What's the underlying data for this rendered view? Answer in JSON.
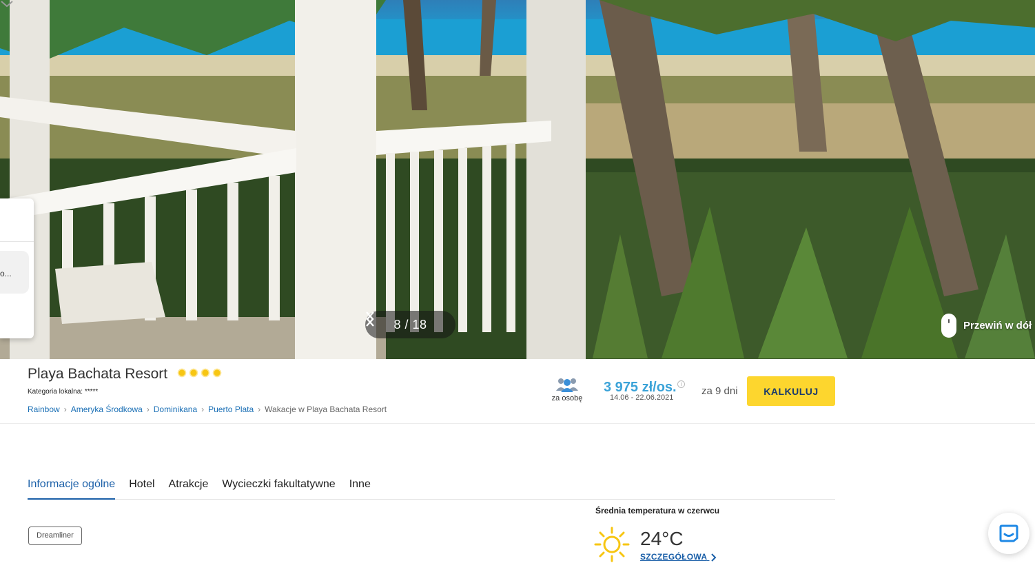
{
  "gallery": {
    "counter": "8 / 18",
    "scroll_hint": "Przewiń w dół",
    "side_card_text": "o..."
  },
  "hotel": {
    "name": "Playa Bachata Resort",
    "star_count": 4,
    "local_category": "Kategoria lokalna: *****"
  },
  "breadcrumb": {
    "items": [
      "Rainbow",
      "Ameryka Środkowa",
      "Dominikana",
      "Puerto Plata"
    ],
    "current": "Wakacje w Playa Bachata Resort"
  },
  "pricing": {
    "per_person_label": "za osobę",
    "price": "3 975 zł/os.",
    "dates": "14.06 - 22.06.2021",
    "duration": "za 9 dni",
    "calculate_label": "KALKULUJ"
  },
  "tabs": [
    "Informacje ogólne",
    "Hotel",
    "Atrakcje",
    "Wycieczki fakultatywne",
    "Inne"
  ],
  "tag": "Dreamliner",
  "weather": {
    "title": "Średnia temperatura w czerwcu",
    "temperature": "24°C",
    "details_link": "SZCZEGÓŁOWA"
  },
  "colors": {
    "accent": "#1a5fa8",
    "price": "#3ba3d8",
    "button": "#fdd62e",
    "star": "#f7c613"
  }
}
